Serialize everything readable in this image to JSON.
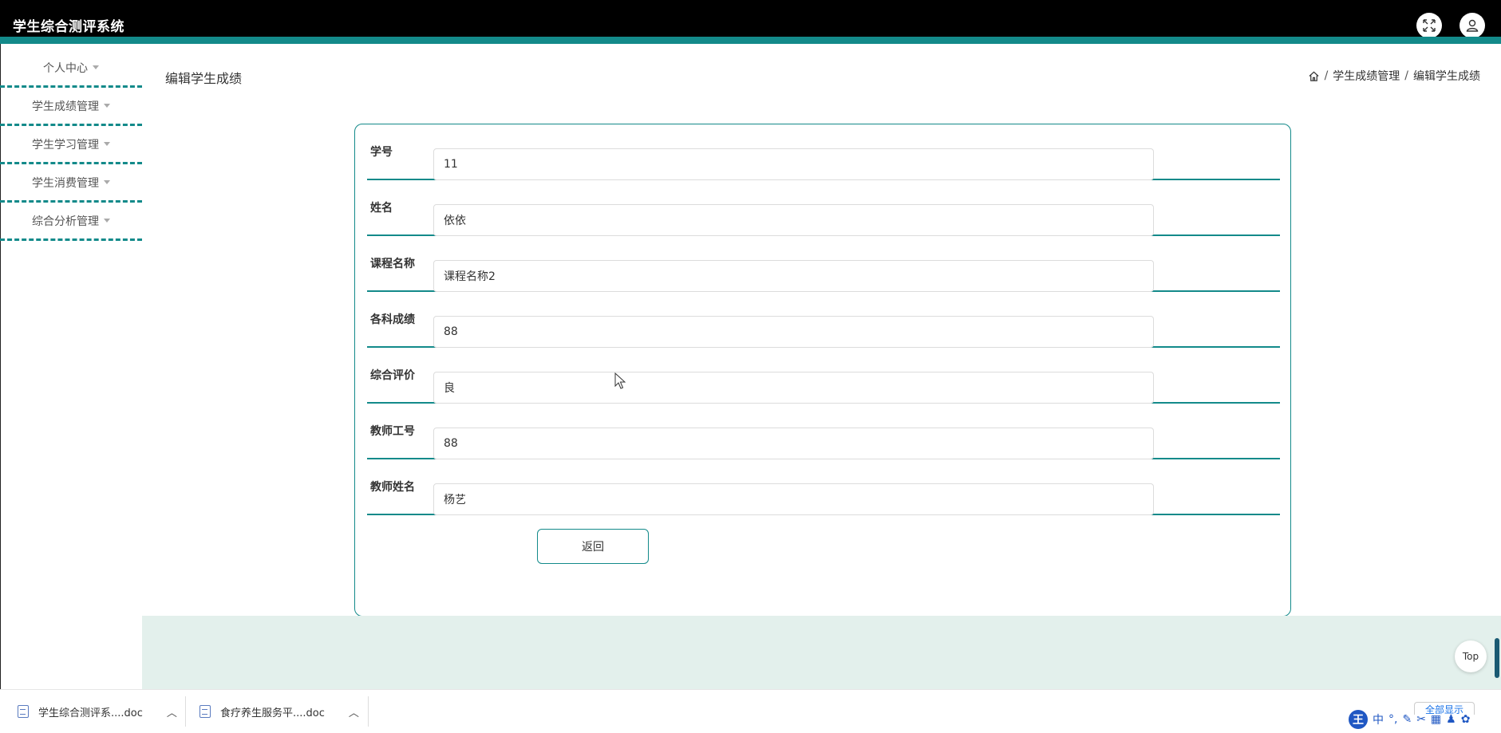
{
  "header": {
    "app_title": "学生综合测评系统",
    "fullscreen_icon": "expand-arrows-icon",
    "user_icon": "user-icon"
  },
  "sidebar": {
    "items": [
      {
        "label": "个人中心"
      },
      {
        "label": "学生成绩管理"
      },
      {
        "label": "学生学习管理"
      },
      {
        "label": "学生消费管理"
      },
      {
        "label": "综合分析管理"
      }
    ]
  },
  "page": {
    "title": "编辑学生成绩",
    "breadcrumb": [
      "学生成绩管理",
      "编辑学生成绩"
    ]
  },
  "form": {
    "fields": [
      {
        "label": "学号",
        "value": "11"
      },
      {
        "label": "姓名",
        "value": "依依"
      },
      {
        "label": "课程名称",
        "value": "课程名称2"
      },
      {
        "label": "各科成绩",
        "value": "88"
      },
      {
        "label": "综合评价",
        "value": "良"
      },
      {
        "label": "教师工号",
        "value": "88"
      },
      {
        "label": "教师姓名",
        "value": "杨艺"
      }
    ],
    "back_label": "返回"
  },
  "top_button": "Top",
  "downloads": {
    "items": [
      {
        "name": "学生综合测评系....doc"
      },
      {
        "name": "食疗养生服务平....doc"
      }
    ],
    "show_all": "全部显示"
  },
  "ime": {
    "logo": "王",
    "mode": "中"
  },
  "colors": {
    "accent": "#138a8a",
    "header_bg": "#000000",
    "footer_bg": "#e3f0ec"
  }
}
